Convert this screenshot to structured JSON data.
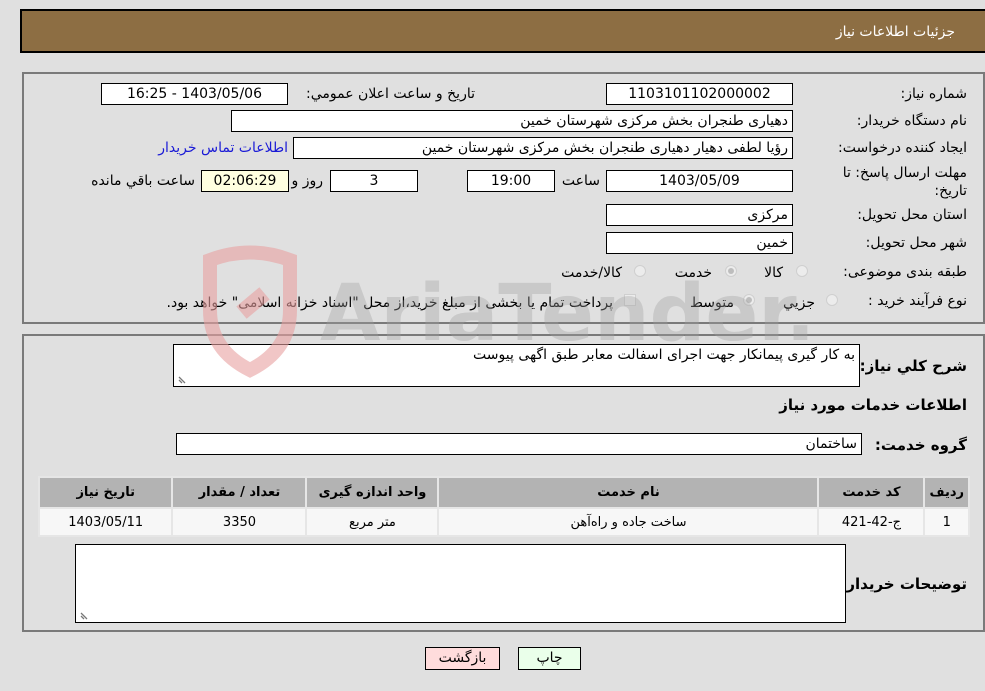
{
  "header": {
    "title": "جزئیات اطلاعات نیاز"
  },
  "details": {
    "need_number_label": "شماره نیاز:",
    "need_number": "1103101102000002",
    "announce_label": "تاریخ و ساعت اعلان عمومي:",
    "announce_value": "1403/05/06 - 16:25",
    "buyer_org_label": "نام دستگاه خریدار:",
    "buyer_org": "دهیاری طنجران بخش مرکزی شهرستان خمین",
    "creator_label": "ایجاد کننده درخواست:",
    "creator": "رؤیا لطفی دهیار  دهیاری طنجران بخش مرکزی شهرستان خمین",
    "contact_link": "اطلاعات تماس خریدار",
    "deadline_label": "مهلت ارسال پاسخ: تا تاریخ:",
    "deadline_date": "1403/05/09",
    "time_label": "ساعت",
    "deadline_time": "19:00",
    "days_value": "3",
    "days_label": "روز و",
    "remaining_time": "02:06:29",
    "remaining_label": "ساعت باقي مانده",
    "province_label": "استان محل تحویل:",
    "province": "مرکزی",
    "city_label": "شهر محل تحویل:",
    "city": "خمین",
    "category_label": "طبقه بندی موضوعی:",
    "category_options": [
      {
        "label": "کالا",
        "checked": false
      },
      {
        "label": "خدمت",
        "checked": true
      },
      {
        "label": "کالا/خدمت",
        "checked": false
      }
    ],
    "process_label": "نوع فرآیند خرید :",
    "process_options": [
      {
        "label": "جزیي",
        "checked": false
      },
      {
        "label": "متوسط",
        "checked": true
      }
    ],
    "treasury_checkbox_checked": false,
    "treasury_note": "پرداخت تمام یا بخشی از مبلغ خرید،از محل \"اسناد خزانه اسلامی\" خواهد بود."
  },
  "description": {
    "label": "شرح کلي نیاز:",
    "value": "به کار گیری پیمانکار جهت اجرای اسفالت معابر طبق اگهی پیوست"
  },
  "services": {
    "section_title": "اطلاعات خدمات مورد نیاز",
    "group_label": "گروه خدمت:",
    "group_value": "ساختمان",
    "columns": [
      "ردیف",
      "کد خدمت",
      "نام خدمت",
      "واحد اندازه گیری",
      "تعداد / مقدار",
      "تاریخ نیاز"
    ],
    "rows": [
      {
        "row": "1",
        "code": "ج-42-421",
        "name": "ساخت جاده و راه‌آهن",
        "unit": "متر مربع",
        "qty": "3350",
        "date": "1403/05/11"
      }
    ]
  },
  "buyer_notes": {
    "label": "توضیحات خریدار:",
    "value": ""
  },
  "buttons": {
    "print": "چاپ",
    "back": "بازگشت"
  },
  "colors": {
    "header_bg": "#8d6e43",
    "print_btn": "#eaffea",
    "back_btn": "#ffdcdc",
    "remaining_bg": "#ffffe0",
    "link": "#1a1ad6"
  },
  "watermark": {
    "text": "AriaTender.neT"
  }
}
